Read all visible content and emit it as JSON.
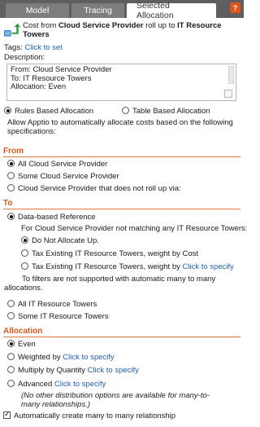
{
  "tabs": [
    {
      "label": "Model"
    },
    {
      "label": "Tracing"
    },
    {
      "label": "Selected Allocation"
    }
  ],
  "help_label": "?",
  "header": {
    "prefix": "Cost from",
    "source": "Cloud Service Provider",
    "middle": "roll up to",
    "target": "IT Resource Towers"
  },
  "tags": {
    "label": "Tags:",
    "link": "Click to set"
  },
  "description": {
    "label": "Description:",
    "lines": [
      "From: Cloud Service Provider",
      "To: IT Resource Towers",
      "Allocation: Even"
    ]
  },
  "allocation_mode": {
    "rules_label": "Rules Based Allocation",
    "table_label": "Table Based Allocation",
    "selected": "rules",
    "info": "Allow Apptio to automatically allocate costs based on the following specifications:"
  },
  "from_section": {
    "title": "From",
    "options": [
      "All Cloud Service Provider",
      "Some Cloud Service Provider",
      "Cloud Service Provider that does not roll up via:"
    ],
    "selected": 0
  },
  "to_section": {
    "title": "To",
    "data_ref_label": "Data-based Reference",
    "not_matching_text": "For Cloud Service Provider not matching any IT Resource Towers:",
    "sub_options": {
      "do_not": "Do Not Allocate Up.",
      "by_cost": "Tax Existing IT Resource Towers, weight by Cost",
      "weight_by": "Tax Existing IT Resource Towers, weight by",
      "weight_by_link": "Click to specify"
    },
    "sub_selected": 0,
    "to_filters_note": "To filters are not supported with automatic many to many allocations.",
    "all_towers": "All IT Resource Towers",
    "some_towers": "Some IT Resource Towers"
  },
  "allocation_section": {
    "title": "Allocation",
    "even": "Even",
    "weighted_by": "Weighted by",
    "multiply_by": "Multiply by Quantity",
    "advanced": "Advanced",
    "link": "Click to specify",
    "selected": "even",
    "note": "(No other distribution options are available for many-to-many relationships.)"
  },
  "auto_create": {
    "label": "Automatically create many to many relationship",
    "checked": true
  },
  "colors": {
    "accent": "#d9581b",
    "link": "#1f5fb0",
    "tabbar": "#5f5f5f"
  }
}
